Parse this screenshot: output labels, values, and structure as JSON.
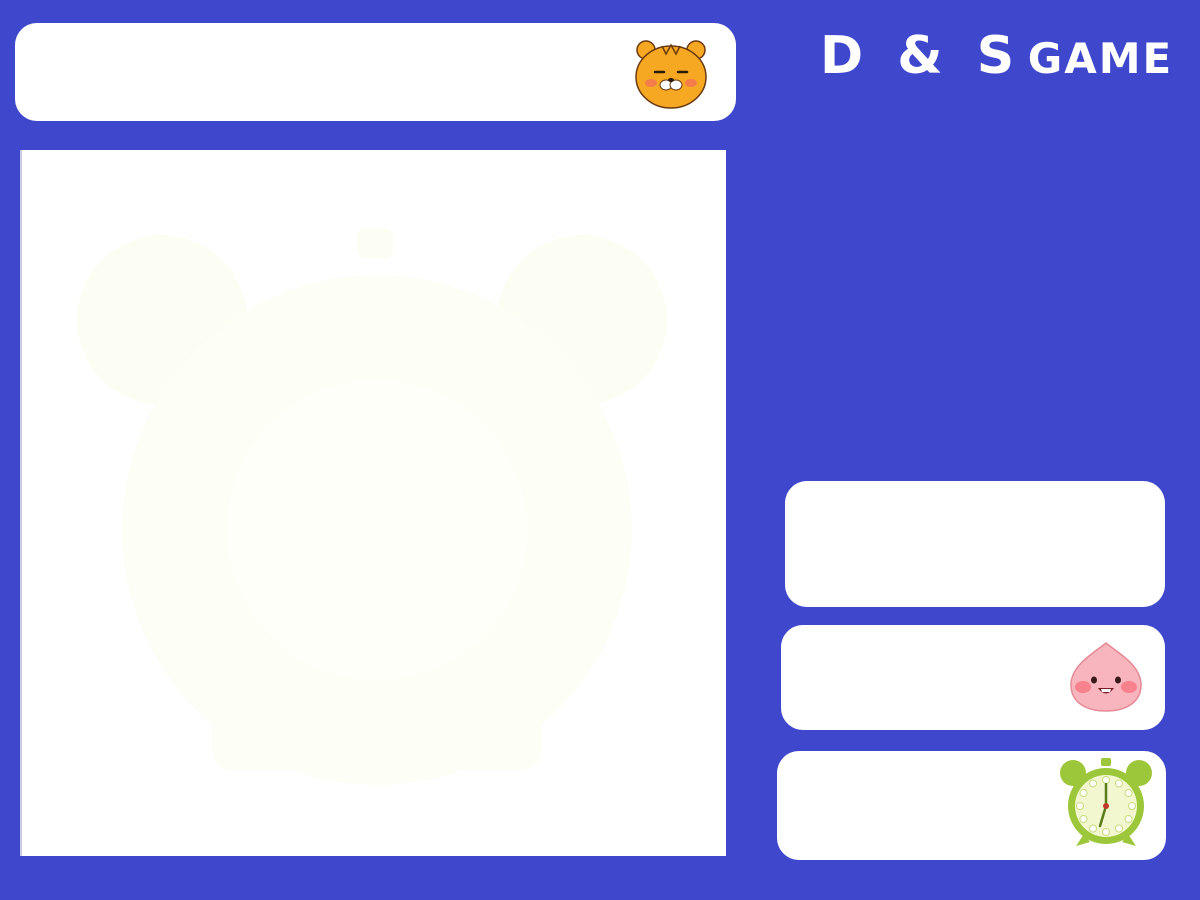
{
  "title": {
    "main": "D & S",
    "sub": "GAME"
  },
  "icons": {
    "player": "lion-face-icon",
    "score": "peach-face-icon",
    "timer": "alarm-clock-icon",
    "board_background": "faded-alarm-clock-icon"
  },
  "colors": {
    "background": "#3f48cc",
    "panel": "#ffffff",
    "title_text": "#ffffff",
    "lion": "#f7a823",
    "peach": "#f9b5bd",
    "clock": "#9dc73a"
  }
}
